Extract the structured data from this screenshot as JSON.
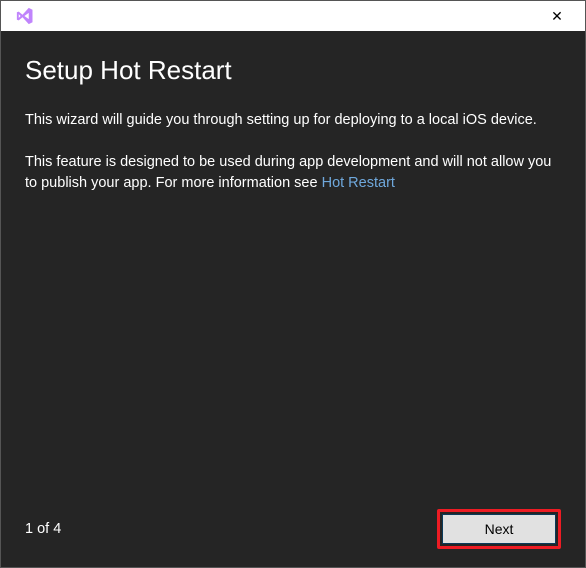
{
  "window": {
    "close_glyph": "✕"
  },
  "header": {
    "title": "Setup Hot Restart"
  },
  "body": {
    "paragraph1": "This wizard will guide you through setting up for deploying to a local iOS device.",
    "paragraph2_prefix": "This feature is designed to be used during app development and will not allow you to publish your app. For more information see ",
    "link_text": "Hot Restart"
  },
  "footer": {
    "page_indicator": "1 of 4",
    "next_label": "Next"
  }
}
